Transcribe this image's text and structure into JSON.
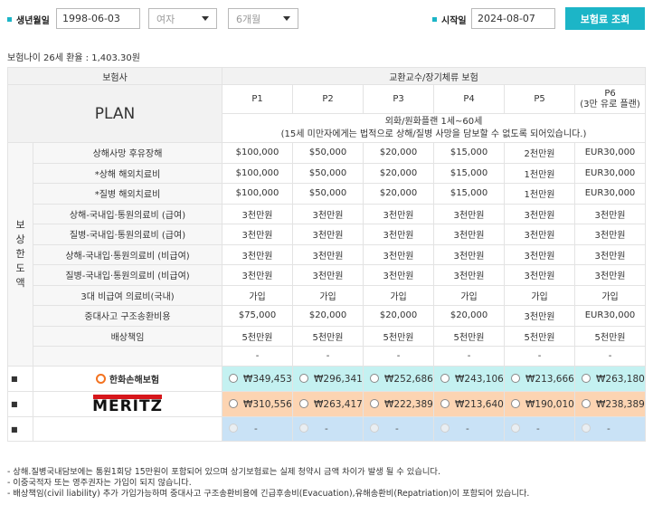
{
  "search": {
    "birth_label": "생년월일",
    "birth_value": "1998-06-03",
    "gender_value": "여자",
    "period_value": "6개월",
    "start_label": "시작일",
    "start_value": "2024-08-07",
    "submit_label": "보험료 조회"
  },
  "summary": "보험나이 26세 환율 : 1,403.30원",
  "table": {
    "insurer_header": "보험사",
    "product_header": "교환교수/장기체류 보험",
    "plan_label": "PLAN",
    "plans": [
      "P1",
      "P2",
      "P3",
      "P4",
      "P5"
    ],
    "plan6_line1": "P6",
    "plan6_line2": "(3만 유로 플랜)",
    "note_line1": "외화/원화플랜 1세~60세",
    "note_line2": "(15세 미만자에게는 법적으로 상해/질병 사망을 담보할 수 없도록 되어있습니다.)",
    "side_label": [
      "보",
      "상",
      "한",
      "도",
      "액"
    ],
    "coverages": [
      {
        "name": "상해사망 후유장해",
        "values": [
          "$100,000",
          "$50,000",
          "$20,000",
          "$15,000",
          "2천만원",
          "EUR30,000"
        ]
      },
      {
        "name": "*상해 해외치료비",
        "values": [
          "$100,000",
          "$50,000",
          "$20,000",
          "$15,000",
          "1천만원",
          "EUR30,000"
        ]
      },
      {
        "name": "*질병 해외치료비",
        "values": [
          "$100,000",
          "$50,000",
          "$20,000",
          "$15,000",
          "1천만원",
          "EUR30,000"
        ]
      },
      {
        "name": "상해-국내입·통원의료비 (급여)",
        "values": [
          "3천만원",
          "3천만원",
          "3천만원",
          "3천만원",
          "3천만원",
          "3천만원"
        ]
      },
      {
        "name": "질병-국내입·통원의료비 (급여)",
        "values": [
          "3천만원",
          "3천만원",
          "3천만원",
          "3천만원",
          "3천만원",
          "3천만원"
        ]
      },
      {
        "name": "상해-국내입·통원의료비 (비급여)",
        "values": [
          "3천만원",
          "3천만원",
          "3천만원",
          "3천만원",
          "3천만원",
          "3천만원"
        ]
      },
      {
        "name": "질병-국내입·통원의료비 (비급여)",
        "values": [
          "3천만원",
          "3천만원",
          "3천만원",
          "3천만원",
          "3천만원",
          "3천만원"
        ]
      },
      {
        "name": "3대 비급여 의료비(국내)",
        "values": [
          "가입",
          "가입",
          "가입",
          "가입",
          "가입",
          "가입"
        ]
      },
      {
        "name": "중대사고 구조송환비용",
        "values": [
          "$75,000",
          "$20,000",
          "$20,000",
          "$20,000",
          "3천만원",
          "EUR30,000"
        ]
      },
      {
        "name": "배상책임",
        "values": [
          "5천만원",
          "5천만원",
          "5천만원",
          "5천만원",
          "5천만원",
          "5천만원"
        ]
      },
      {
        "name": "",
        "values": [
          "-",
          "-",
          "-",
          "-",
          "-",
          "-"
        ]
      }
    ],
    "insurers": [
      {
        "name": "한화손해보험",
        "premiums": [
          "₩349,453",
          "₩296,341",
          "₩252,686",
          "₩243,106",
          "₩213,666",
          "₩263,180"
        ]
      },
      {
        "name": "MERITZ",
        "premiums": [
          "₩310,556",
          "₩263,417",
          "₩222,389",
          "₩213,640",
          "₩190,010",
          "₩238,389"
        ]
      },
      {
        "name": "",
        "premiums": [
          "-",
          "-",
          "-",
          "-",
          "-",
          "-"
        ]
      }
    ],
    "insurer_marker": "■"
  },
  "notes": [
    "- 상해.질병국내담보에는 통원1회당 15만원이 포함되어 있으며 상기보험료는 실제 청약시 금액 차이가 발생 될 수 있습니다.",
    "- 이중국적자 또는 영주권자는 가입이 되지 않습니다.",
    "- 배상책임(civil liability) 추가 가입가능하며 중대사고 구조송환비용에 긴급후송비(Evacuation),유해송환비(Repatriation)이 포함되어 있습니다."
  ],
  "colors": {
    "accent": "#1cb5c7",
    "hanwha_row": "#c4f1f1",
    "meritz_row": "#fcd4b2",
    "empty_row": "#c9e2f6",
    "meritz_red": "#d7161b"
  }
}
